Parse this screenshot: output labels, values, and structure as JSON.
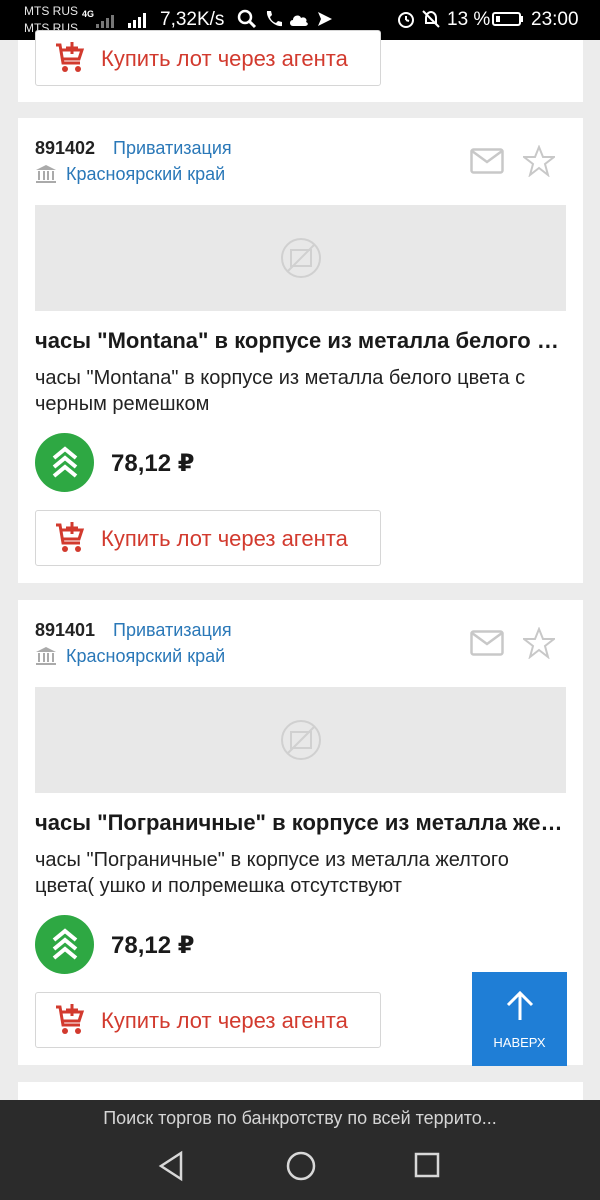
{
  "status_bar": {
    "carrier1": "MTS RUS",
    "carrier2": "MTS RUS",
    "network": "4G",
    "speed": "7,32K/s",
    "battery": "13 %",
    "time": "23:00"
  },
  "buy_label": "Купить лот через агента",
  "lots": [
    {
      "id": "891402",
      "type": "Приватизация",
      "region": "Красноярский край",
      "title": "часы \"Montana\" в корпусе из металла белого цвета с черным ремешком",
      "description": "часы \"Montana\" в корпусе из металла белого цвета с черным ремешком",
      "price": "78,12 ₽"
    },
    {
      "id": "891401",
      "type": "Приватизация",
      "region": "Красноярский край",
      "title": "часы \"Пограничные\" в корпусе из металла желтого цвета",
      "description": "часы \"Пограничные\" в корпусе из металла желтого цвета( ушко и полремешка отсутствуют",
      "price": "78,12 ₽"
    }
  ],
  "scroll_top_label": "НАВЕРХ",
  "bottom_caption": "Поиск торгов по банкротству по всей террито...",
  "colors": {
    "accent_blue": "#1f7ed6",
    "link_blue": "#2a78b8",
    "buy_red": "#d23a2e",
    "badge_green": "#2ea843"
  }
}
